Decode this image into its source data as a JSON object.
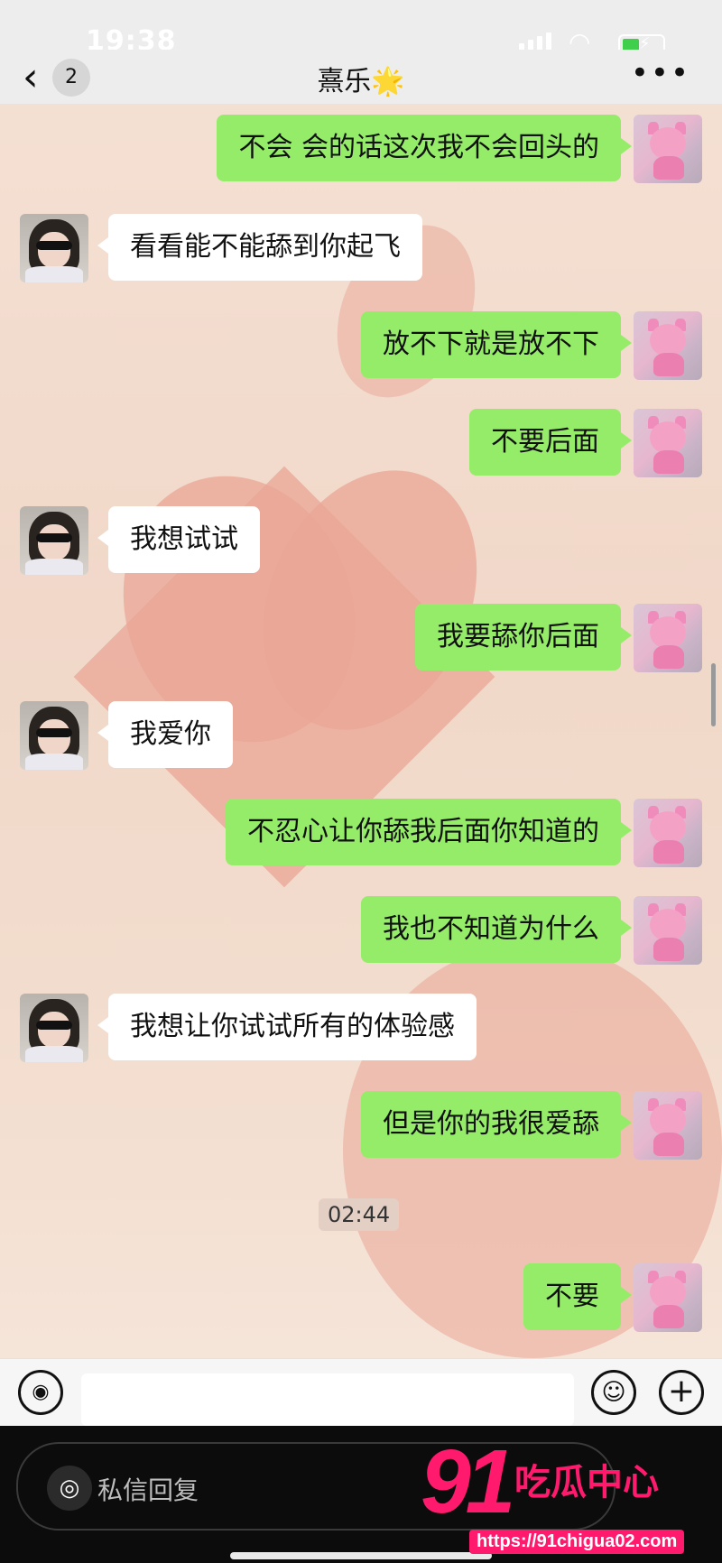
{
  "status_bar": {
    "time": "19:38"
  },
  "header": {
    "back_badge": "2",
    "title": "熹乐",
    "title_emoji": "🌟",
    "more": "•••"
  },
  "messages": [
    {
      "from": "me",
      "text": "不会 会的话这次我不会回头的"
    },
    {
      "from": "other",
      "text": "看看能不能舔到你起飞"
    },
    {
      "from": "me",
      "text": "放不下就是放不下"
    },
    {
      "from": "me",
      "text": "不要后面"
    },
    {
      "from": "other",
      "text": "我想试试"
    },
    {
      "from": "me",
      "text": "我要舔你后面"
    },
    {
      "from": "other",
      "text": "我爱你"
    },
    {
      "from": "me",
      "text": "不忍心让你舔我后面你知道的"
    },
    {
      "from": "me",
      "text": "我也不知道为什么"
    },
    {
      "from": "other",
      "text": "我想让你试试所有的体验感"
    },
    {
      "from": "me",
      "text": "但是你的我很爱舔"
    },
    {
      "from": "me",
      "text": "不要"
    }
  ],
  "timestamp": "02:44",
  "dm_reply_placeholder": "私信回复",
  "watermark": {
    "number": "91",
    "text": "吃瓜中心",
    "url": "https://91chigua02.com"
  }
}
